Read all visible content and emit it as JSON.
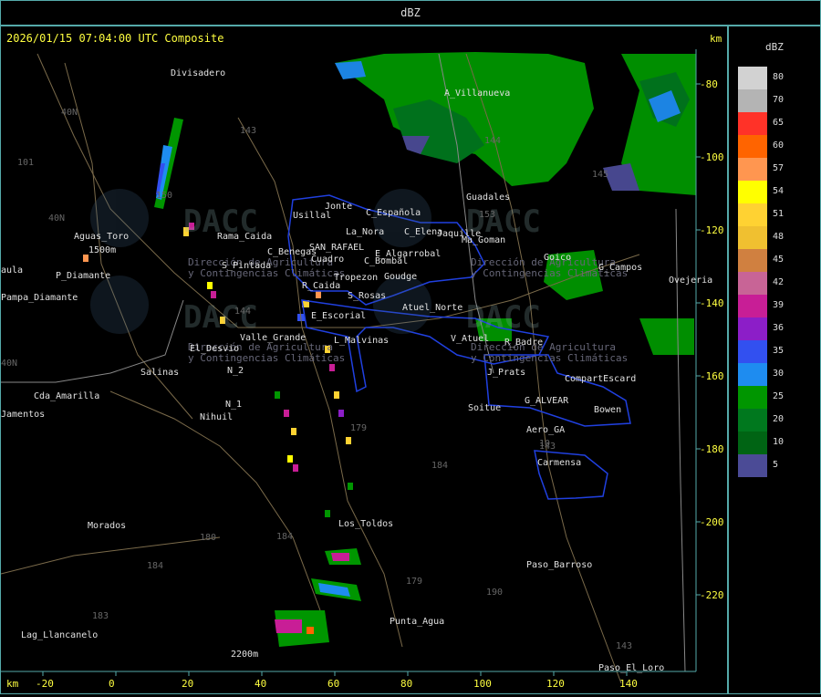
{
  "header": {
    "title": "dBZ"
  },
  "map": {
    "timestamp": "2026/01/15 07:04:00 UTC Composite",
    "x_unit": "km",
    "y_unit": "km",
    "x_ticks": [
      "-20",
      "0",
      "20",
      "40",
      "60",
      "80",
      "100",
      "120",
      "140"
    ],
    "y_ticks": [
      "-80",
      "-100",
      "-120",
      "-140",
      "-160",
      "-180",
      "-200",
      "-220"
    ],
    "watermark_lines": [
      "Dirección de Agricultura",
      "y Contingencias Climáticas"
    ],
    "places": [
      {
        "name": "Divisadero"
      },
      {
        "name": "A_Villanueva"
      },
      {
        "name": "Guadales"
      },
      {
        "name": "Usillal"
      },
      {
        "name": "Jonte"
      },
      {
        "name": "C_Española"
      },
      {
        "name": "La_Nora"
      },
      {
        "name": "C_Elena"
      },
      {
        "name": "Jaquille"
      },
      {
        "name": "Ma_Goman"
      },
      {
        "name": "Rama_Caida"
      },
      {
        "name": "C_Benegas"
      },
      {
        "name": "SAN_RAFAEL"
      },
      {
        "name": "E_Algarrobal"
      },
      {
        "name": "Goico"
      },
      {
        "name": "G_Campos"
      },
      {
        "name": "Ovejeria"
      },
      {
        "name": "Aguas_Toro"
      },
      {
        "name": "S_Pintada"
      },
      {
        "name": "Cuadro"
      },
      {
        "name": "C_Bombal"
      },
      {
        "name": "Tropezon"
      },
      {
        "name": "Goudge"
      },
      {
        "name": "Pampa_Diamante"
      },
      {
        "name": "P_Diamante"
      },
      {
        "name": "R_Caida"
      },
      {
        "name": "S_Rosas"
      },
      {
        "name": "Atuel_Norte"
      },
      {
        "name": "E_Escorial"
      },
      {
        "name": "Valle_Grande"
      },
      {
        "name": "L_Malvinas"
      },
      {
        "name": "V_Atuel"
      },
      {
        "name": "R_Badre"
      },
      {
        "name": "El_Desvio"
      },
      {
        "name": "Salinas"
      },
      {
        "name": "N_1"
      },
      {
        "name": "N_2"
      },
      {
        "name": "J_Prats"
      },
      {
        "name": "CompartEscard"
      },
      {
        "name": "Cda_Amarilla"
      },
      {
        "name": "Nihuil"
      },
      {
        "name": "G_ALVEAR"
      },
      {
        "name": "Bowen"
      },
      {
        "name": "Soitue"
      },
      {
        "name": "Aero_GA"
      },
      {
        "name": "Carmensa"
      },
      {
        "name": "Morados"
      },
      {
        "name": "Los_Toldos"
      },
      {
        "name": "Paso_Barroso"
      },
      {
        "name": "Punta_Agua"
      },
      {
        "name": "Lag_Llancanelo"
      },
      {
        "name": "Paso_El_Loro"
      },
      {
        "name": "Jamentos"
      },
      {
        "name": "1500m"
      },
      {
        "name": "2200m"
      },
      {
        "name": "aula"
      }
    ],
    "route_labels": [
      "143",
      "101",
      "40N",
      "40N",
      "40N",
      "150",
      "144",
      "179",
      "184",
      "180",
      "184",
      "183",
      "184",
      "179",
      "190",
      "143",
      "145",
      "153",
      "143",
      "144",
      "10"
    ]
  },
  "legend": {
    "unit": "dBZ",
    "entries": [
      {
        "label": "80",
        "color": "#d2d2d2"
      },
      {
        "label": "70",
        "color": "#b4b4b4"
      },
      {
        "label": "65",
        "color": "#ff3228"
      },
      {
        "label": "60",
        "color": "#ff6400"
      },
      {
        "label": "57",
        "color": "#ff9650"
      },
      {
        "label": "54",
        "color": "#ffff00"
      },
      {
        "label": "51",
        "color": "#ffd232"
      },
      {
        "label": "48",
        "color": "#f0c030"
      },
      {
        "label": "45",
        "color": "#d08040"
      },
      {
        "label": "42",
        "color": "#c86496"
      },
      {
        "label": "39",
        "color": "#c81e96"
      },
      {
        "label": "36",
        "color": "#8c1ec8"
      },
      {
        "label": "35",
        "color": "#3250f0"
      },
      {
        "label": "30",
        "color": "#1e8cf0"
      },
      {
        "label": "25",
        "color": "#009600"
      },
      {
        "label": "20",
        "color": "#00781e"
      },
      {
        "label": "10",
        "color": "#006414"
      },
      {
        "label": "5",
        "color": "#4b4b96"
      }
    ]
  }
}
